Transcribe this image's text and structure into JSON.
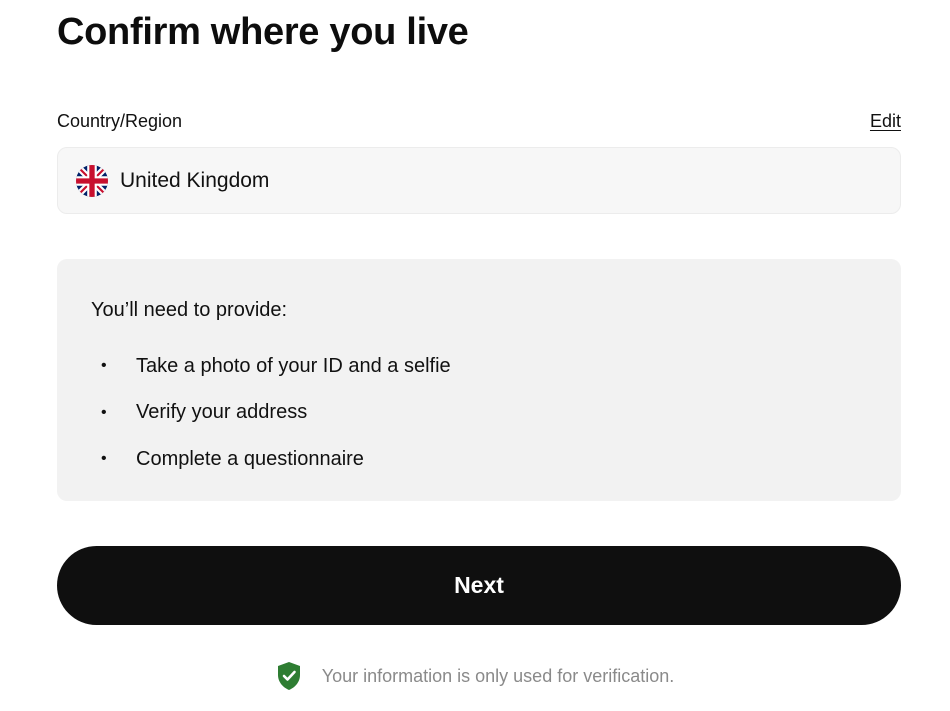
{
  "page": {
    "title": "Confirm where you live"
  },
  "country_field": {
    "label": "Country/Region",
    "edit_label": "Edit",
    "value": "United Kingdom",
    "flag_icon": "uk-flag-icon"
  },
  "requirements": {
    "heading": "You’ll need to provide:",
    "bullet": "•",
    "items": [
      "Take a photo of your ID and a selfie",
      "Verify your address",
      "Complete a questionnaire"
    ]
  },
  "next_button": {
    "label": "Next"
  },
  "privacy": {
    "icon": "shield-check-icon",
    "icon_color": "#2e7d32",
    "text": "Your information is only used for verification."
  },
  "colors": {
    "button_bg": "#0f0f0f",
    "field_bg": "#f7f7f7",
    "info_bg": "#f2f2f2",
    "muted_text": "#8a8a8a"
  }
}
